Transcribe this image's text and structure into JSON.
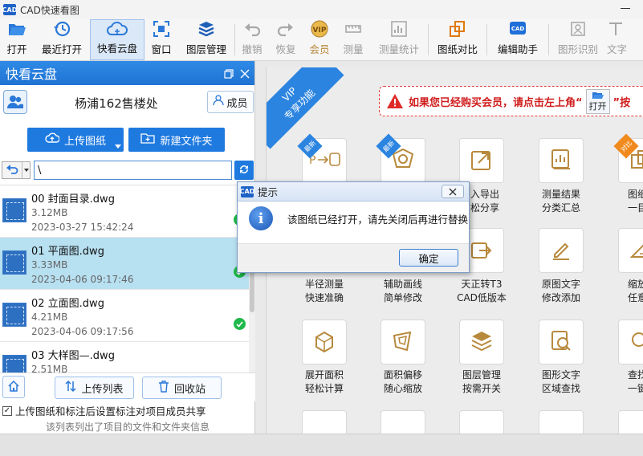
{
  "window": {
    "title": "CAD快速看图",
    "icon_text": "CAD"
  },
  "toolbar": {
    "items": [
      {
        "label": "打开"
      },
      {
        "label": "最近打开"
      },
      {
        "label": "快看云盘"
      },
      {
        "label": "窗口"
      },
      {
        "label": "图层管理"
      },
      {
        "label": "撤销"
      },
      {
        "label": "恢复"
      },
      {
        "label": "会员"
      },
      {
        "label": "测量"
      },
      {
        "label": "测量统计"
      },
      {
        "label": "图纸对比"
      },
      {
        "label": "编辑助手"
      },
      {
        "label": "图形识别"
      },
      {
        "label": "文字"
      }
    ],
    "vip_badge": "VIP"
  },
  "panel": {
    "title": "快看云盘",
    "project_name": "杨浦162售楼处",
    "member_label": "成员",
    "upload_label": "上传图纸",
    "new_folder_label": "新建文件夹",
    "path_value": "\\",
    "files": [
      {
        "name": "00 封面目录.dwg",
        "size": "3.12MB",
        "date": "2023-03-27 15:42:24"
      },
      {
        "name": "01 平面图.dwg",
        "size": "3.33MB",
        "date": "2023-04-06 09:17:46"
      },
      {
        "name": "02 立面图.dwg",
        "size": "4.21MB",
        "date": "2023-04-06 09:17:56"
      },
      {
        "name": "03 大样图—.dwg",
        "size": "2.51MB",
        "date": ""
      }
    ],
    "upload_list_label": "上传列表",
    "recycle_label": "回收站",
    "share_checkbox_label": "上传图纸和标注后设置标注对项目成员共享",
    "footnote": "该列表列出了项目的文件和文件夹信息"
  },
  "right": {
    "vip_ribbon_line1": "VIP",
    "vip_ribbon_line2": "专享功能",
    "banner_text_pre": "如果您已经购买会员，请点击左上角“",
    "banner_open_label": "打开",
    "banner_text_post": "”按",
    "tag_new": "最新",
    "tag_compare": "对比",
    "features": [
      {
        "line1": "",
        "line2": ""
      },
      {
        "line1": "",
        "line2": ""
      },
      {
        "line1": "入导出",
        "line2": "松分享"
      },
      {
        "line1": "测量结果",
        "line2": "分类汇总"
      },
      {
        "line1": "图纸对",
        "line2": "一目了"
      },
      {
        "line1": "半径测量",
        "line2": "快速准确"
      },
      {
        "line1": "辅助画线",
        "line2": "简单修改"
      },
      {
        "line1": "天正转T3",
        "line2": "CAD低版本"
      },
      {
        "line1": "原图文字",
        "line2": "修改添加"
      },
      {
        "line1": "缩放测",
        "line2": "任意比"
      },
      {
        "line1": "展开面积",
        "line2": "轻松计算"
      },
      {
        "line1": "面积偏移",
        "line2": "随心缩放"
      },
      {
        "line1": "图层管理",
        "line2": "按需开关"
      },
      {
        "line1": "图形文字",
        "line2": "区域查找"
      },
      {
        "line1": "查找图",
        "line2": "一键导"
      }
    ]
  },
  "dialog": {
    "title": "提示",
    "message": "该图纸已经打开，请先关闭后再进行替换",
    "ok_label": "确定"
  },
  "colors": {
    "accent": "#1f7ae0",
    "gold": "#b8893c",
    "selected_row": "#b7e0f1",
    "success": "#1fb84a",
    "warning": "#d01c1c"
  }
}
